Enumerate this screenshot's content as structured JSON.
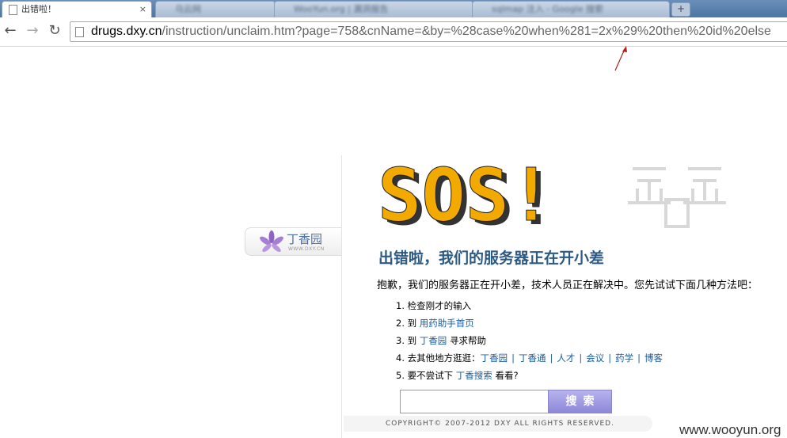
{
  "browser": {
    "active_tab": {
      "title": "出错啦！",
      "close": "×"
    },
    "tabs": [
      {
        "title": "乌云网"
      },
      {
        "title": "WooYun.org | 漏洞报告"
      },
      {
        "title": "sqlmap 注入 - Google 搜索"
      }
    ],
    "new_tab": "+",
    "nav": {
      "back": "←",
      "forward": "→",
      "reload": "↻"
    },
    "url_host": "drugs.dxy.cn",
    "url_path": "/instruction/unclaim.htm?page=758&cnName=&by=%28case%20when%281=2x%29%20then%20id%20else"
  },
  "page": {
    "logo_text": "丁香园",
    "logo_subtext": "WWW.DXY.CN",
    "sos_text": "SOS!",
    "title": "出错啦，我们的服务器正在开小差",
    "intro": "抱歉，我们的服务器正在开小差，技术人员正在解决中。您先试试下面几种方法吧：",
    "items": {
      "i1": {
        "text": "1. 检查刚才的输入"
      },
      "i2": {
        "prefix": "2. 到 ",
        "link": "用药助手首页"
      },
      "i3": {
        "prefix": "3. 到 ",
        "link": "丁香园",
        "suffix": " 寻求帮助"
      },
      "i4": {
        "prefix": "4. 去其他地方逛逛：",
        "links": [
          "丁香园",
          "丁香通",
          "人才",
          "会议",
          "药学",
          "博客"
        ],
        "sep": "|"
      },
      "i5": {
        "prefix": "5. 要不尝试下 ",
        "link": "丁香搜索",
        "suffix": " 看看?"
      }
    },
    "search": {
      "value": "",
      "button": "搜索"
    },
    "copyright": "COPYRIGHT© 2007-2012 DXY ALL RIGHTS RESERVED.",
    "watermark": "www.wooyun.org"
  },
  "colors": {
    "sos": "#f2a900",
    "title": "#2d5a84",
    "link": "#1b5c9e",
    "search_button": "#9a96e0"
  }
}
